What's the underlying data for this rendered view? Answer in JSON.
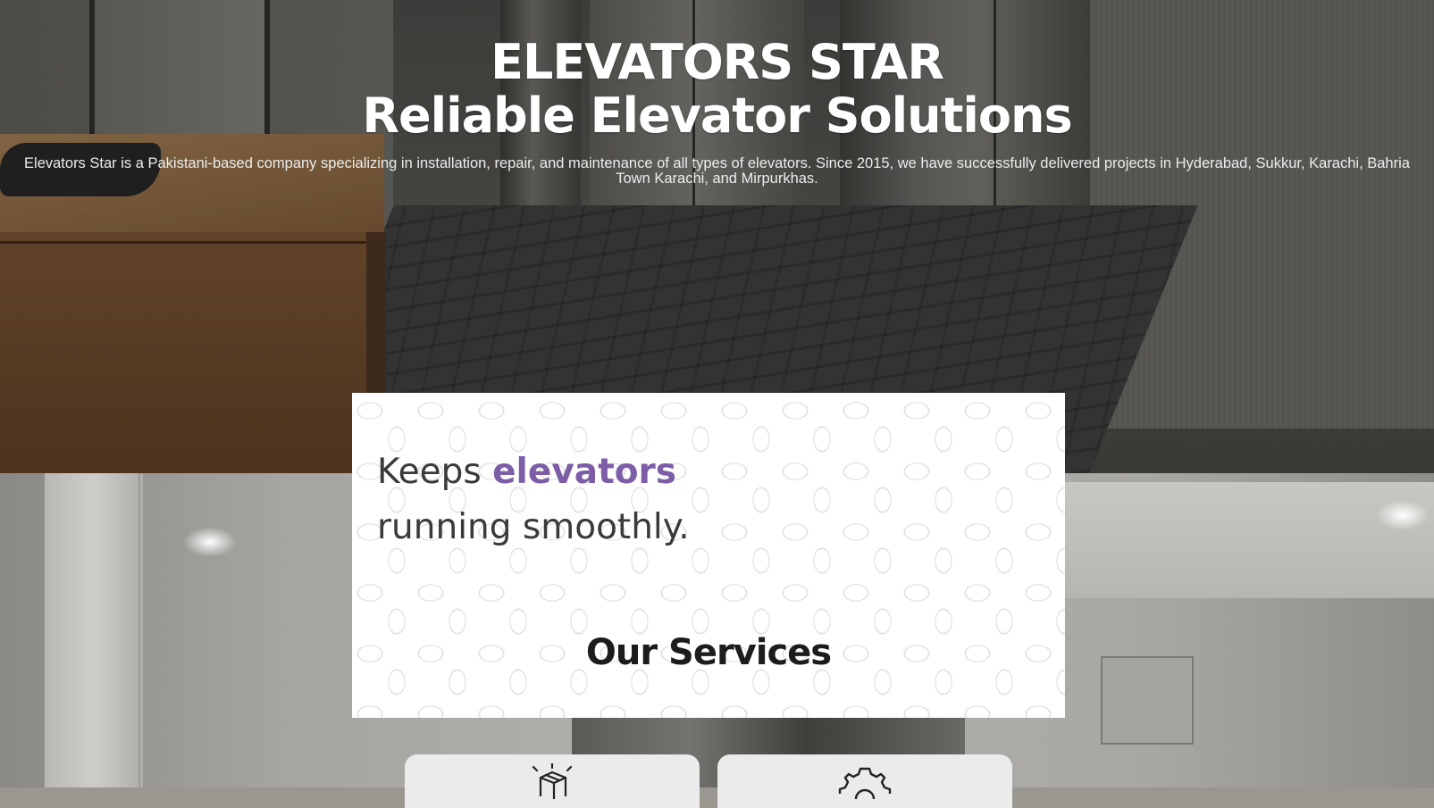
{
  "hero": {
    "title_line1": "ELEVATORS STAR",
    "title_line2": "Reliable Elevator Solutions",
    "description": "Elevators Star is a Pakistani-based company specializing in installation, repair, and maintenance of all types of elevators. Since 2015, we have successfully delivered projects in Hyderabad, Sukkur, Karachi, Bahria Town Karachi, and Mirpurkhas."
  },
  "intro": {
    "tagline_part1": "Keeps ",
    "tagline_highlight": "elevators",
    "tagline_part2": "running smoothly.",
    "highlight_color": "#7c5da6"
  },
  "services": {
    "title": "Our Services",
    "cards": [
      {
        "icon": "package-icon"
      },
      {
        "icon": "gear-icon"
      }
    ]
  }
}
